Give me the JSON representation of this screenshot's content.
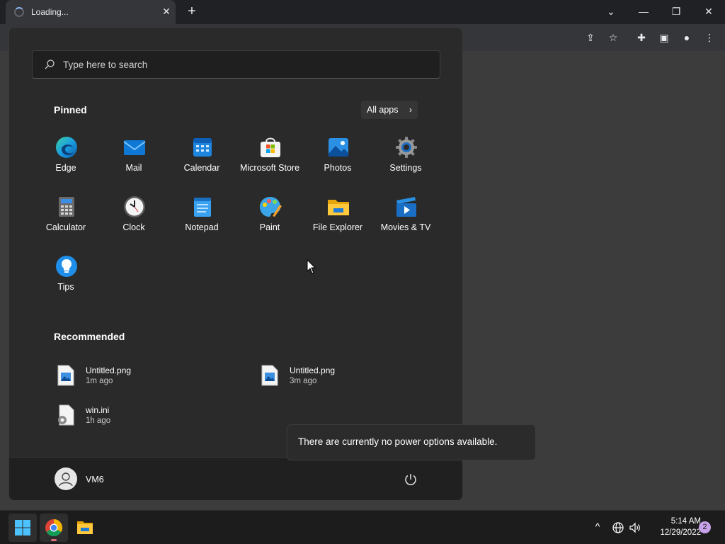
{
  "browser": {
    "tab_title": "Loading...",
    "tab_close_icon": "close-icon",
    "new_tab_icon": "plus-icon"
  },
  "window_controls": {
    "tab_search_icon": "chevron-down-icon",
    "minimize_icon": "minimize-icon",
    "restore_icon": "restore-icon",
    "close_icon": "close-icon"
  },
  "toolbar": {
    "icons": [
      "share-icon",
      "star-icon",
      "extensions-icon",
      "side-panel-icon",
      "profile-icon",
      "more-icon"
    ]
  },
  "start_menu": {
    "search": {
      "placeholder": "Type here to search"
    },
    "pinned_title": "Pinned",
    "all_apps_label": "All apps",
    "pinned_apps": [
      {
        "label": "Edge",
        "icon": "edge-icon"
      },
      {
        "label": "Mail",
        "icon": "mail-icon"
      },
      {
        "label": "Calendar",
        "icon": "calendar-icon"
      },
      {
        "label": "Microsoft Store",
        "icon": "store-icon"
      },
      {
        "label": "Photos",
        "icon": "photos-icon"
      },
      {
        "label": "Settings",
        "icon": "settings-icon"
      },
      {
        "label": "Calculator",
        "icon": "calculator-icon"
      },
      {
        "label": "Clock",
        "icon": "clock-icon"
      },
      {
        "label": "Notepad",
        "icon": "notepad-icon"
      },
      {
        "label": "Paint",
        "icon": "paint-icon"
      },
      {
        "label": "File Explorer",
        "icon": "folder-icon"
      },
      {
        "label": "Movies & TV",
        "icon": "movies-icon"
      },
      {
        "label": "Tips",
        "icon": "tips-icon"
      }
    ],
    "recommended_title": "Recommended",
    "recommended": [
      {
        "name": "Untitled.png",
        "time": "1m ago",
        "icon": "image-file-icon"
      },
      {
        "name": "Untitled.png",
        "time": "3m ago",
        "icon": "image-file-icon"
      },
      {
        "name": "win.ini",
        "time": "1h ago",
        "icon": "settings-file-icon"
      }
    ],
    "user_name": "VM6",
    "power_icon": "power-icon"
  },
  "tooltip": {
    "text": "There are currently no power options available."
  },
  "taskbar": {
    "apps": [
      {
        "name": "Start",
        "icon": "windows-logo-icon"
      },
      {
        "name": "Google Chrome",
        "icon": "chrome-icon"
      },
      {
        "name": "File Explorer",
        "icon": "folder-icon"
      }
    ],
    "tray_icons": [
      "chevron-up-icon",
      "network-icon",
      "volume-icon"
    ],
    "time": "5:14 AM",
    "date": "12/29/2022",
    "notification_count": "2"
  },
  "colors": {
    "accent": "#0078d4",
    "start_bg": "#2a2a2a",
    "taskbar_bg": "#1c1c1c",
    "badge": "#c7a2e8"
  }
}
